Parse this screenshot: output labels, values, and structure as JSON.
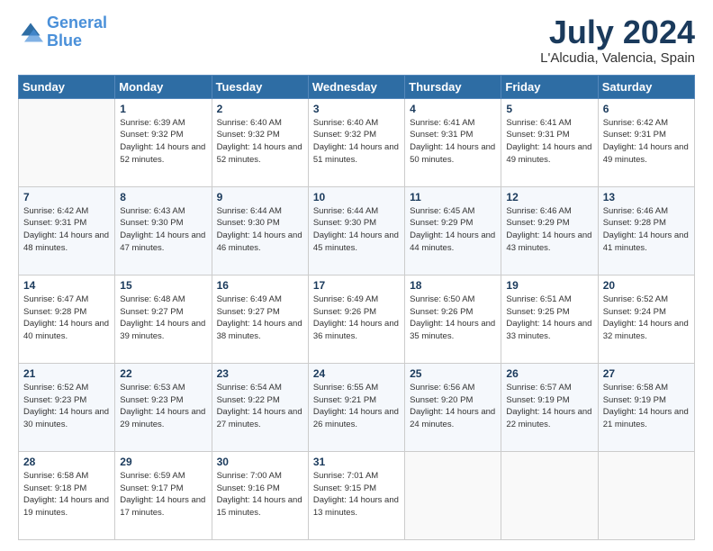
{
  "logo": {
    "line1": "General",
    "line2": "Blue"
  },
  "title": "July 2024",
  "subtitle": "L'Alcudia, Valencia, Spain",
  "header_days": [
    "Sunday",
    "Monday",
    "Tuesday",
    "Wednesday",
    "Thursday",
    "Friday",
    "Saturday"
  ],
  "weeks": [
    [
      {
        "day": "",
        "sunrise": "",
        "sunset": "",
        "daylight": ""
      },
      {
        "day": "1",
        "sunrise": "Sunrise: 6:39 AM",
        "sunset": "Sunset: 9:32 PM",
        "daylight": "Daylight: 14 hours and 52 minutes."
      },
      {
        "day": "2",
        "sunrise": "Sunrise: 6:40 AM",
        "sunset": "Sunset: 9:32 PM",
        "daylight": "Daylight: 14 hours and 52 minutes."
      },
      {
        "day": "3",
        "sunrise": "Sunrise: 6:40 AM",
        "sunset": "Sunset: 9:32 PM",
        "daylight": "Daylight: 14 hours and 51 minutes."
      },
      {
        "day": "4",
        "sunrise": "Sunrise: 6:41 AM",
        "sunset": "Sunset: 9:31 PM",
        "daylight": "Daylight: 14 hours and 50 minutes."
      },
      {
        "day": "5",
        "sunrise": "Sunrise: 6:41 AM",
        "sunset": "Sunset: 9:31 PM",
        "daylight": "Daylight: 14 hours and 49 minutes."
      },
      {
        "day": "6",
        "sunrise": "Sunrise: 6:42 AM",
        "sunset": "Sunset: 9:31 PM",
        "daylight": "Daylight: 14 hours and 49 minutes."
      }
    ],
    [
      {
        "day": "7",
        "sunrise": "Sunrise: 6:42 AM",
        "sunset": "Sunset: 9:31 PM",
        "daylight": "Daylight: 14 hours and 48 minutes."
      },
      {
        "day": "8",
        "sunrise": "Sunrise: 6:43 AM",
        "sunset": "Sunset: 9:30 PM",
        "daylight": "Daylight: 14 hours and 47 minutes."
      },
      {
        "day": "9",
        "sunrise": "Sunrise: 6:44 AM",
        "sunset": "Sunset: 9:30 PM",
        "daylight": "Daylight: 14 hours and 46 minutes."
      },
      {
        "day": "10",
        "sunrise": "Sunrise: 6:44 AM",
        "sunset": "Sunset: 9:30 PM",
        "daylight": "Daylight: 14 hours and 45 minutes."
      },
      {
        "day": "11",
        "sunrise": "Sunrise: 6:45 AM",
        "sunset": "Sunset: 9:29 PM",
        "daylight": "Daylight: 14 hours and 44 minutes."
      },
      {
        "day": "12",
        "sunrise": "Sunrise: 6:46 AM",
        "sunset": "Sunset: 9:29 PM",
        "daylight": "Daylight: 14 hours and 43 minutes."
      },
      {
        "day": "13",
        "sunrise": "Sunrise: 6:46 AM",
        "sunset": "Sunset: 9:28 PM",
        "daylight": "Daylight: 14 hours and 41 minutes."
      }
    ],
    [
      {
        "day": "14",
        "sunrise": "Sunrise: 6:47 AM",
        "sunset": "Sunset: 9:28 PM",
        "daylight": "Daylight: 14 hours and 40 minutes."
      },
      {
        "day": "15",
        "sunrise": "Sunrise: 6:48 AM",
        "sunset": "Sunset: 9:27 PM",
        "daylight": "Daylight: 14 hours and 39 minutes."
      },
      {
        "day": "16",
        "sunrise": "Sunrise: 6:49 AM",
        "sunset": "Sunset: 9:27 PM",
        "daylight": "Daylight: 14 hours and 38 minutes."
      },
      {
        "day": "17",
        "sunrise": "Sunrise: 6:49 AM",
        "sunset": "Sunset: 9:26 PM",
        "daylight": "Daylight: 14 hours and 36 minutes."
      },
      {
        "day": "18",
        "sunrise": "Sunrise: 6:50 AM",
        "sunset": "Sunset: 9:26 PM",
        "daylight": "Daylight: 14 hours and 35 minutes."
      },
      {
        "day": "19",
        "sunrise": "Sunrise: 6:51 AM",
        "sunset": "Sunset: 9:25 PM",
        "daylight": "Daylight: 14 hours and 33 minutes."
      },
      {
        "day": "20",
        "sunrise": "Sunrise: 6:52 AM",
        "sunset": "Sunset: 9:24 PM",
        "daylight": "Daylight: 14 hours and 32 minutes."
      }
    ],
    [
      {
        "day": "21",
        "sunrise": "Sunrise: 6:52 AM",
        "sunset": "Sunset: 9:23 PM",
        "daylight": "Daylight: 14 hours and 30 minutes."
      },
      {
        "day": "22",
        "sunrise": "Sunrise: 6:53 AM",
        "sunset": "Sunset: 9:23 PM",
        "daylight": "Daylight: 14 hours and 29 minutes."
      },
      {
        "day": "23",
        "sunrise": "Sunrise: 6:54 AM",
        "sunset": "Sunset: 9:22 PM",
        "daylight": "Daylight: 14 hours and 27 minutes."
      },
      {
        "day": "24",
        "sunrise": "Sunrise: 6:55 AM",
        "sunset": "Sunset: 9:21 PM",
        "daylight": "Daylight: 14 hours and 26 minutes."
      },
      {
        "day": "25",
        "sunrise": "Sunrise: 6:56 AM",
        "sunset": "Sunset: 9:20 PM",
        "daylight": "Daylight: 14 hours and 24 minutes."
      },
      {
        "day": "26",
        "sunrise": "Sunrise: 6:57 AM",
        "sunset": "Sunset: 9:19 PM",
        "daylight": "Daylight: 14 hours and 22 minutes."
      },
      {
        "day": "27",
        "sunrise": "Sunrise: 6:58 AM",
        "sunset": "Sunset: 9:19 PM",
        "daylight": "Daylight: 14 hours and 21 minutes."
      }
    ],
    [
      {
        "day": "28",
        "sunrise": "Sunrise: 6:58 AM",
        "sunset": "Sunset: 9:18 PM",
        "daylight": "Daylight: 14 hours and 19 minutes."
      },
      {
        "day": "29",
        "sunrise": "Sunrise: 6:59 AM",
        "sunset": "Sunset: 9:17 PM",
        "daylight": "Daylight: 14 hours and 17 minutes."
      },
      {
        "day": "30",
        "sunrise": "Sunrise: 7:00 AM",
        "sunset": "Sunset: 9:16 PM",
        "daylight": "Daylight: 14 hours and 15 minutes."
      },
      {
        "day": "31",
        "sunrise": "Sunrise: 7:01 AM",
        "sunset": "Sunset: 9:15 PM",
        "daylight": "Daylight: 14 hours and 13 minutes."
      },
      {
        "day": "",
        "sunrise": "",
        "sunset": "",
        "daylight": ""
      },
      {
        "day": "",
        "sunrise": "",
        "sunset": "",
        "daylight": ""
      },
      {
        "day": "",
        "sunrise": "",
        "sunset": "",
        "daylight": ""
      }
    ]
  ]
}
